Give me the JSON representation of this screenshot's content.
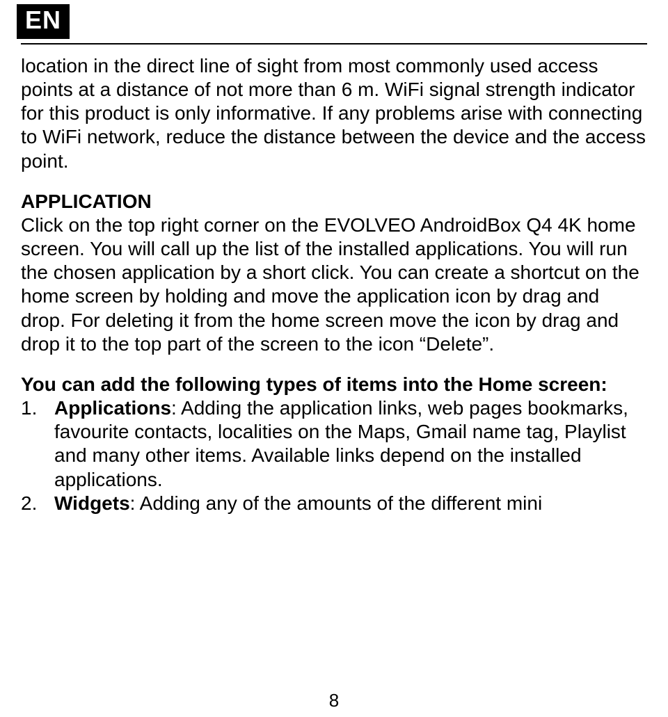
{
  "lang": "EN",
  "para1": "location in the direct line of sight from most commonly used access points at a distance of not more than 6 m. WiFi signal strength indicator for this product is only informative. If any problems arise with connecting to WiFi network, reduce the distance between the device and the access point.",
  "section_title": "APPLICATION",
  "para2": "Click on the top right corner on the EVOLVEO AndroidBox Q4 4K home screen. You will call up the list of the installed applications. You will run the chosen application by a short click. You can create a shortcut on the home screen by holding and move the application icon by drag and drop. For deleting it from the home screen move the icon by drag and drop it to the top part of the screen to the icon “Delete”.",
  "subhead": "You can add the following types of items into the Home screen:",
  "items": [
    {
      "label": "Applications",
      "text": ": Adding the application links, web pages bookmarks, favourite contacts, localities on the Maps, Gmail name tag, Playlist and many other items. Available links depend on the installed applications."
    },
    {
      "label": "Widgets",
      "text": ": Adding any of the amounts of the different mini"
    }
  ],
  "page_number": "8"
}
